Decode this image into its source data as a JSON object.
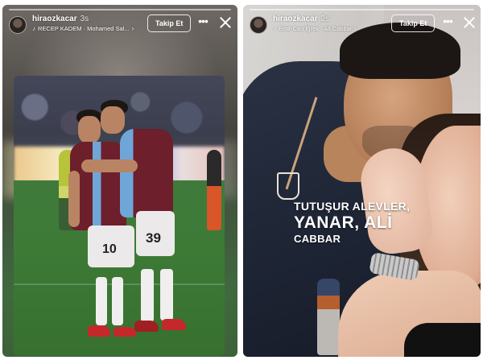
{
  "stories": [
    {
      "username": "hiraozkacar",
      "time": "3s",
      "music": "RECEP KADEM · Mohamed Sal...",
      "follow_label": "Takip Et",
      "more_label": "•••",
      "jersey_numbers": [
        "10",
        "39"
      ]
    },
    {
      "username": "hiraozkacar",
      "time": "2s",
      "music": "Emir Can İğrek · Ali Cabbar",
      "follow_label": "Takip Et",
      "more_label": "•••",
      "text_lines": [
        "TUTUŞUR ALEVLER,",
        "YANAR, ALİ",
        "CABBAR"
      ]
    }
  ],
  "icons": {
    "music": "♪",
    "chevron": "›"
  }
}
